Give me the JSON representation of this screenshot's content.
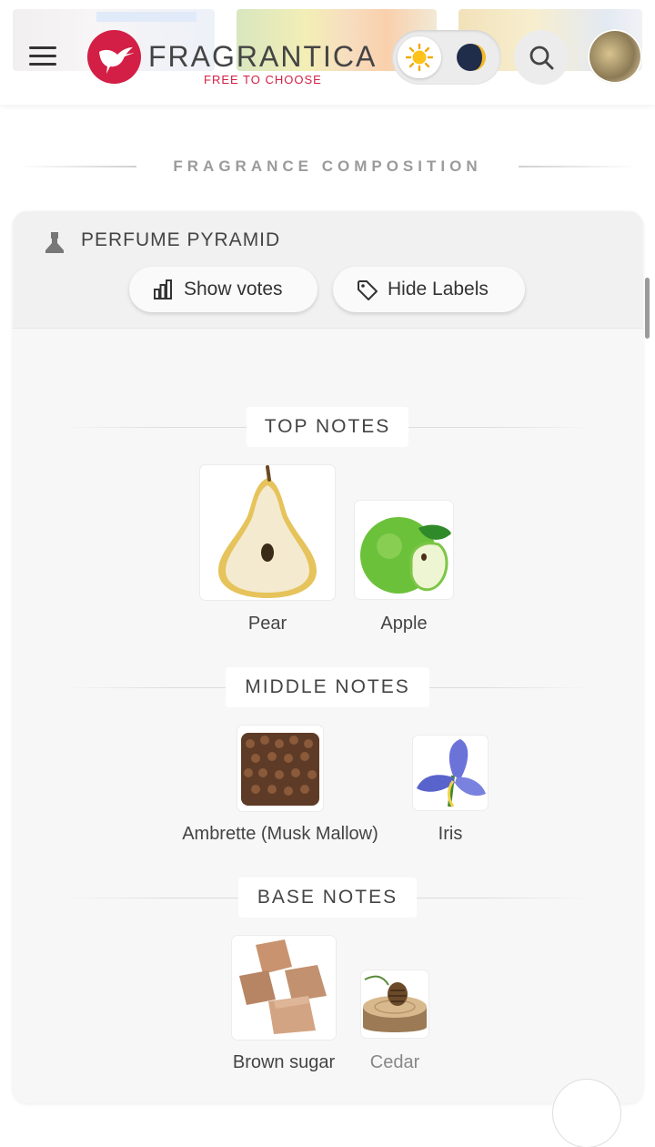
{
  "header": {
    "brand": "FRAGRANTICA",
    "tagline": "FREE TO CHOOSE",
    "icons": {
      "menu": "hamburger-menu-icon",
      "logo": "hummingbird-logo-icon",
      "light_mode": "sun-icon",
      "dark_mode": "moon-icon",
      "search": "search-icon",
      "avatar": "user-avatar"
    },
    "brand_color": "#d31f45"
  },
  "section": {
    "title": "FRAGRANCE COMPOSITION"
  },
  "pyramid": {
    "title": "PERFUME PYRAMID",
    "title_icon": "flask-icon",
    "buttons": {
      "show_votes": "Show votes",
      "show_votes_icon": "bar-chart-icon",
      "hide_labels": "Hide Labels",
      "hide_labels_icon": "tag-icon"
    },
    "groups": {
      "top": {
        "title": "TOP NOTES",
        "notes": [
          {
            "name": "Pear",
            "image": "pear-image"
          },
          {
            "name": "Apple",
            "image": "apple-image"
          }
        ]
      },
      "middle": {
        "title": "MIDDLE NOTES",
        "notes": [
          {
            "name": "Ambrette (Musk Mallow)",
            "image": "ambrette-seeds-image"
          },
          {
            "name": "Iris",
            "image": "iris-flower-image"
          }
        ]
      },
      "base": {
        "title": "BASE NOTES",
        "notes": [
          {
            "name": "Brown sugar",
            "image": "brown-sugar-image"
          },
          {
            "name": "Cedar",
            "image": "cedar-image"
          }
        ]
      }
    }
  }
}
